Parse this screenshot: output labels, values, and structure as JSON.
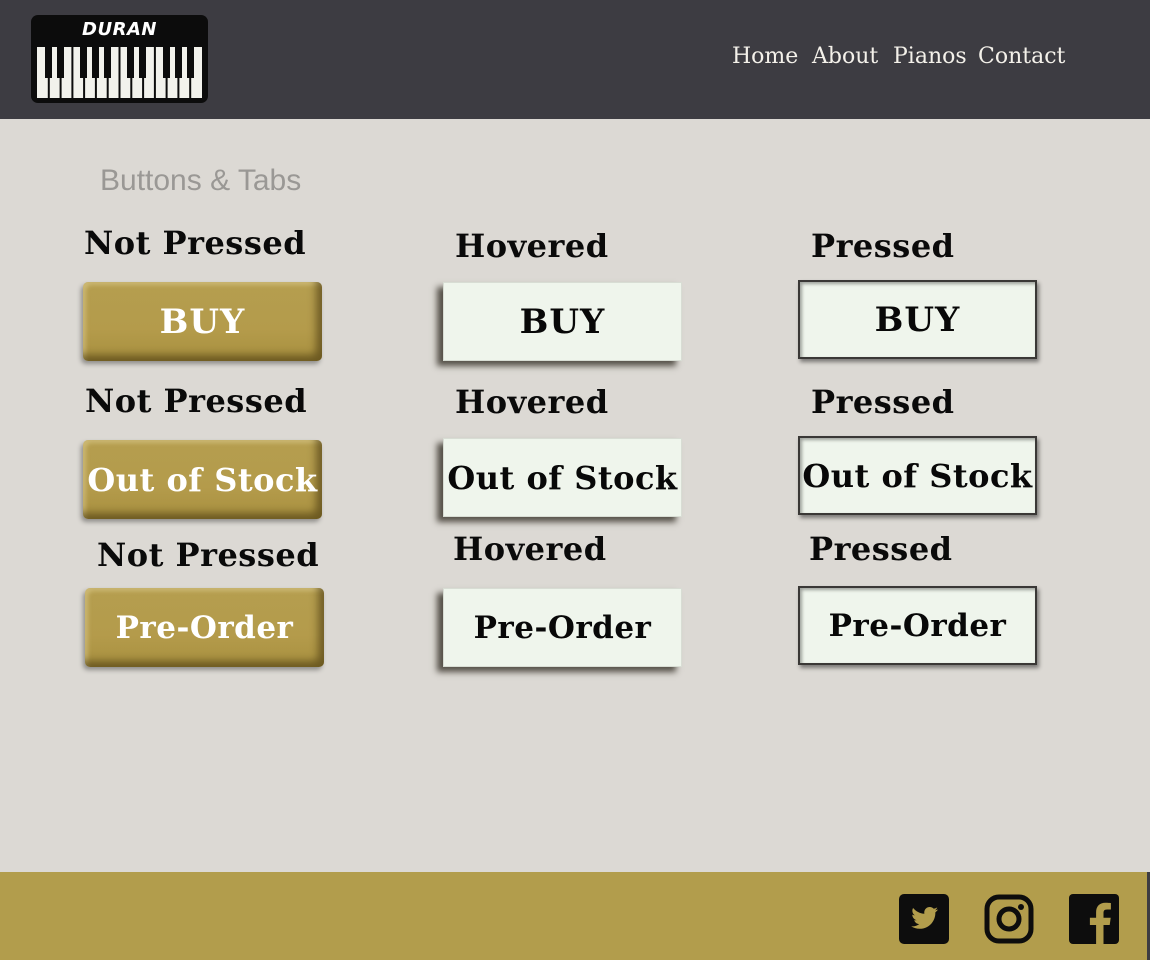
{
  "header": {
    "logo_text": "DURAN",
    "nav": [
      "Home",
      "About",
      "Pianos",
      "Contact"
    ]
  },
  "main": {
    "section_title": "Buttons & Tabs",
    "rows": [
      {
        "label": "BUY",
        "states": [
          "Not Pressed",
          "Hovered",
          "Pressed"
        ]
      },
      {
        "label": "Out of Stock",
        "states": [
          "Not Pressed",
          "Hovered",
          "Pressed"
        ]
      },
      {
        "label": "Pre-Order",
        "states": [
          "Not Pressed",
          "Hovered",
          "Pressed"
        ]
      }
    ]
  },
  "footer": {
    "social_icons": [
      "twitter-icon",
      "instagram-icon",
      "facebook-icon"
    ]
  },
  "colors": {
    "header_bg": "#3d3c42",
    "page_bg": "#dcd9d4",
    "gold": "#b29d4c",
    "button_light": "#eff5ec"
  }
}
